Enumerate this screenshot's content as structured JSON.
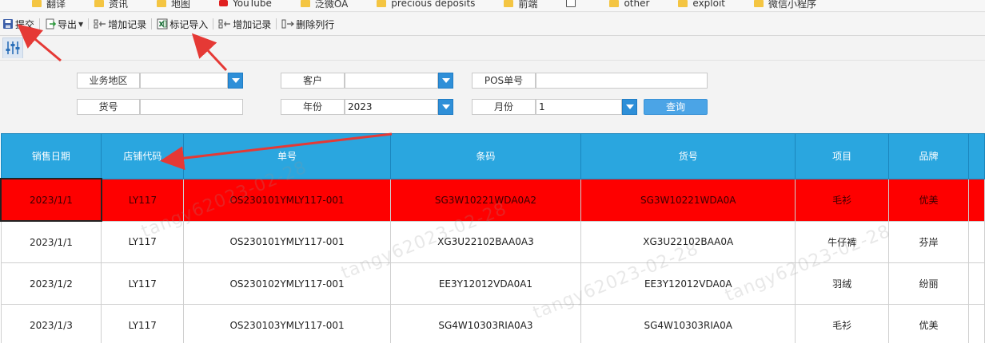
{
  "bookmarks": [
    {
      "label": "翻译",
      "icon": "folder-icon"
    },
    {
      "label": "资讯",
      "icon": "folder-icon"
    },
    {
      "label": "地图",
      "icon": "folder-icon"
    },
    {
      "label": "YouTube",
      "icon": "youtube-icon"
    },
    {
      "label": "泛微OA",
      "icon": "folder-icon"
    },
    {
      "label": "precious deposits",
      "icon": "folder-icon"
    },
    {
      "label": "前端",
      "icon": "folder-icon"
    },
    {
      "label": "",
      "icon": "image-icon"
    },
    {
      "label": "other",
      "icon": "folder-icon"
    },
    {
      "label": "exploit",
      "icon": "folder-icon"
    },
    {
      "label": "微信小程序",
      "icon": "folder-icon"
    }
  ],
  "toolbar": {
    "submit": "提交",
    "export": "导出",
    "add_record_1": "增加记录",
    "mark_import": "标记导入",
    "add_record_2": "增加记录",
    "delete_column": "删除列行"
  },
  "form": {
    "region_label": "业务地区",
    "region_value": "",
    "customer_label": "客户",
    "customer_value": "",
    "pos_label": "POS单号",
    "pos_value": "",
    "item_no_label": "货号",
    "item_no_value": "",
    "year_label": "年份",
    "year_value": "2023",
    "month_label": "月份",
    "month_value": "1",
    "query_button": "查询"
  },
  "table": {
    "columns": [
      "销售日期",
      "店铺代码",
      "单号",
      "条码",
      "货号",
      "项目",
      "品牌"
    ],
    "rows": [
      [
        "2023/1/1",
        "LY117",
        "OS230101YMLY117-001",
        "SG3W10221WDA0A2",
        "SG3W10221WDA0A",
        "毛衫",
        "优美"
      ],
      [
        "2023/1/1",
        "LY117",
        "OS230101YMLY117-001",
        "XG3U22102BAA0A3",
        "XG3U22102BAA0A",
        "牛仔裤",
        "芬岸"
      ],
      [
        "2023/1/2",
        "LY117",
        "OS230102YMLY117-001",
        "EE3Y12012VDA0A1",
        "EE3Y12012VDA0A",
        "羽绒",
        "纷丽"
      ],
      [
        "2023/1/3",
        "LY117",
        "OS230103YMLY117-001",
        "SG4W10303RIA0A3",
        "SG4W10303RIA0A",
        "毛衫",
        "优美"
      ]
    ],
    "selected_row": 0
  },
  "watermark": "tangy62023-02-28",
  "colors": {
    "header_bg": "#2aa6df",
    "selected_row": "#fe0000",
    "dropdown_button": "#2e8fd8",
    "query_button": "#4ba4e6",
    "annotation_arrow": "#e53935"
  }
}
